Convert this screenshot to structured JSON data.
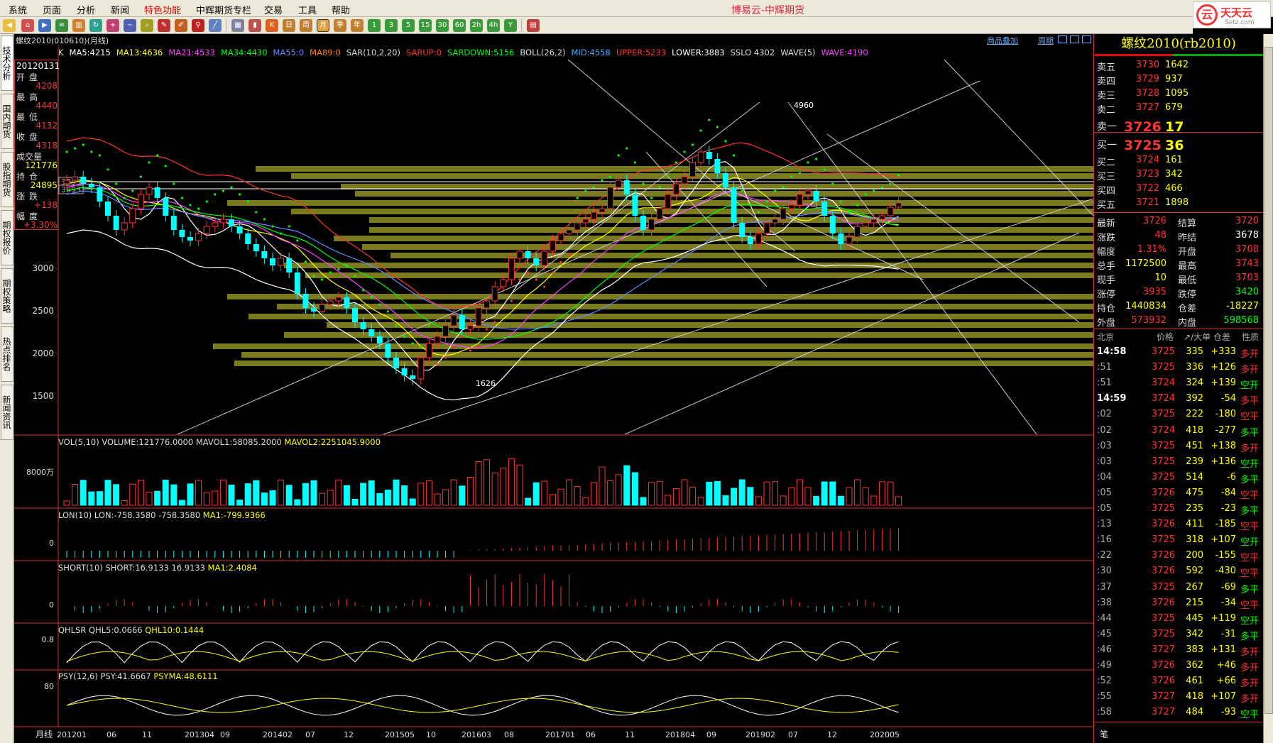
{
  "menu": {
    "items": [
      "系统",
      "页面",
      "分析",
      "新闻",
      "特色功能",
      "中辉期货专栏",
      "交易",
      "工具",
      "帮助"
    ],
    "app_title": "博易云-中辉期货"
  },
  "logo": {
    "mark": "云",
    "text": "天天云",
    "url": "Setz.com"
  },
  "toolbar": {
    "period_buttons": [
      "日",
      "周",
      "月",
      "季",
      "年"
    ]
  },
  "left_tabs": [
    "技术分析",
    "国内期货",
    "股指期货",
    "期权报价",
    "期权策略",
    "热点排名",
    "新闻资讯"
  ],
  "chart": {
    "title": "螺纹2010(010610)(月线)",
    "overlay_link": "商品叠加",
    "period_link": "周期",
    "indicator_line": [
      {
        "text": "K",
        "color": "#dddddd"
      },
      {
        "text": "MA5:4215",
        "color": "#ffffff"
      },
      {
        "text": "MA13:4636",
        "color": "#ffff00"
      },
      {
        "text": "MA21:4533",
        "color": "#ff44ff"
      },
      {
        "text": "MA34:4430",
        "color": "#00ff00"
      },
      {
        "text": "MA55:0",
        "color": "#6688ff"
      },
      {
        "text": "MA89:0",
        "color": "#ff7f00"
      },
      {
        "text": "SAR(10,2,20)",
        "color": "#dddddd"
      },
      {
        "text": "SARUP:0",
        "color": "#ff3333"
      },
      {
        "text": "SARDOWN:5156",
        "color": "#00ff00"
      },
      {
        "text": "BOLL(26,2)",
        "color": "#dddddd"
      },
      {
        "text": "MID:4558",
        "color": "#44aaff"
      },
      {
        "text": "UPPER:5233",
        "color": "#ff3333"
      },
      {
        "text": "LOWER:3883",
        "color": "#ffffff"
      },
      {
        "text": "SSLO 4302",
        "color": "#dddddd"
      },
      {
        "text": "WAVE(5)",
        "color": "#dddddd"
      },
      {
        "text": "WAVE:4190",
        "color": "#ff44ff"
      }
    ],
    "info_box": {
      "date": "20120131",
      "rows": [
        {
          "label": "开盘",
          "value": "4208"
        },
        {
          "label": "最高",
          "value": "4440"
        },
        {
          "label": "最低",
          "value": "4132"
        },
        {
          "label": "收盘",
          "value": "4318"
        },
        {
          "label": "成交量",
          "value": "121776"
        },
        {
          "label": "持仓",
          "value": "24895"
        },
        {
          "label": "涨跌",
          "value": "+138"
        },
        {
          "label": "幅度",
          "value": "+3.30%"
        }
      ]
    },
    "price_axis": [
      "3000",
      "2500",
      "2000",
      "1500"
    ],
    "price_tags": [
      "3993",
      "3893"
    ],
    "annotations": {
      "high": "4960",
      "low": "1626"
    },
    "vol_panel": {
      "label": "VOL(5,10)  VOLUME:121776.0000  MAVOL1:58085.2000",
      "label2": "MAVOL2:2251045.9000",
      "axis": "8000万"
    },
    "lon_panel": {
      "label": "LON(10)  LON:-758.3580  -758.3580",
      "label2": "MA1:-799.9366",
      "axis": "0"
    },
    "short_panel": {
      "label": "SHORT(10)  SHORT:16.9133  16.9133",
      "label2": "MA1:2.4084",
      "axis": "0"
    },
    "qhlsr_panel": {
      "label": "QHLSR  QHL5:0.0666",
      "label2": "QHL10:0.1444",
      "axis": "0.8"
    },
    "psy_panel": {
      "label": "PSY(12,6)  PSY:41.6667",
      "label2": "PSYMA:48.6111",
      "axis": "80"
    },
    "x_axis_label": "月线",
    "x_axis": [
      "201201",
      "06",
      "11",
      "201304",
      "09",
      "201402",
      "07",
      "12",
      "201505",
      "10",
      "201603",
      "08",
      "201701",
      "06",
      "11",
      "201804",
      "09",
      "201902",
      "07",
      "12",
      "202005"
    ]
  },
  "quote": {
    "title": "螺纹2010(rb2010)",
    "asks": [
      {
        "label": "卖五",
        "price": "3730",
        "vol": "1642"
      },
      {
        "label": "卖四",
        "price": "3729",
        "vol": "937"
      },
      {
        "label": "卖三",
        "price": "3728",
        "vol": "1095"
      },
      {
        "label": "卖二",
        "price": "3727",
        "vol": "679"
      },
      {
        "label": "卖一",
        "price": "3726",
        "vol": "17"
      }
    ],
    "bids": [
      {
        "label": "买一",
        "price": "3725",
        "vol": "36"
      },
      {
        "label": "买二",
        "price": "3724",
        "vol": "161"
      },
      {
        "label": "买三",
        "price": "3723",
        "vol": "342"
      },
      {
        "label": "买四",
        "price": "3722",
        "vol": "466"
      },
      {
        "label": "买五",
        "price": "3721",
        "vol": "1898"
      }
    ],
    "stats": [
      {
        "l1": "最新",
        "v1": "3726",
        "c1": "#ff3333",
        "l2": "结算",
        "v2": "3720",
        "c2": "#ff3333"
      },
      {
        "l1": "涨跌",
        "v1": "48",
        "c1": "#ff3333",
        "l2": "昨结",
        "v2": "3678",
        "c2": "#ffffff"
      },
      {
        "l1": "幅度",
        "v1": "1.31%",
        "c1": "#ff3333",
        "l2": "开盘",
        "v2": "3708",
        "c2": "#ff3333"
      },
      {
        "l1": "总手",
        "v1": "1172500",
        "c1": "#ffff00",
        "l2": "最高",
        "v2": "3743",
        "c2": "#ff3333"
      },
      {
        "l1": "现手",
        "v1": "10",
        "c1": "#ffff00",
        "l2": "最低",
        "v2": "3703",
        "c2": "#ff3333"
      },
      {
        "l1": "涨停",
        "v1": "3935",
        "c1": "#ff3333",
        "l2": "跌停",
        "v2": "3420",
        "c2": "#00ff00"
      },
      {
        "l1": "持仓",
        "v1": "1440834",
        "c1": "#ffff00",
        "l2": "仓差",
        "v2": "-18227",
        "c2": "#ffff00"
      },
      {
        "l1": "外盘",
        "v1": "573932",
        "c1": "#ff3333",
        "l2": "内盘",
        "v2": "598568",
        "c2": "#00ff00"
      }
    ],
    "tick_header": [
      "北京",
      "价格",
      "↗/大单",
      "仓差",
      "性质"
    ],
    "ticks": [
      {
        "t": "14:58",
        "p": "3725",
        "v": "335",
        "d": "+333",
        "n": "多开",
        "tc": "#ffffff",
        "nc": "#ff3333"
      },
      {
        "t": ":51",
        "p": "3725",
        "v": "336",
        "d": "+126",
        "n": "多开",
        "tc": "#aaaaaa",
        "nc": "#ff3333"
      },
      {
        "t": ":51",
        "p": "3724",
        "v": "324",
        "d": "+139",
        "n": "空开",
        "tc": "#aaaaaa",
        "nc": "#00ff00"
      },
      {
        "t": "14:59",
        "p": "3724",
        "v": "392",
        "d": "-54",
        "n": "多平",
        "tc": "#ffffff",
        "nc": "#ff3333"
      },
      {
        "t": ":02",
        "p": "3725",
        "v": "222",
        "d": "-180",
        "n": "空平",
        "tc": "#aaaaaa",
        "nc": "#ff3333"
      },
      {
        "t": ":02",
        "p": "3724",
        "v": "418",
        "d": "-277",
        "n": "多平",
        "tc": "#aaaaaa",
        "nc": "#00ff00"
      },
      {
        "t": ":03",
        "p": "3725",
        "v": "451",
        "d": "+138",
        "n": "多开",
        "tc": "#aaaaaa",
        "nc": "#ff3333"
      },
      {
        "t": ":03",
        "p": "3725",
        "v": "239",
        "d": "+136",
        "n": "空开",
        "tc": "#aaaaaa",
        "nc": "#00ff00"
      },
      {
        "t": ":04",
        "p": "3725",
        "v": "514",
        "d": "-6",
        "n": "多平",
        "tc": "#aaaaaa",
        "nc": "#00ff00"
      },
      {
        "t": ":05",
        "p": "3726",
        "v": "475",
        "d": "-84",
        "n": "空平",
        "tc": "#aaaaaa",
        "nc": "#ff3333"
      },
      {
        "t": ":05",
        "p": "3725",
        "v": "235",
        "d": "-23",
        "n": "多平",
        "tc": "#aaaaaa",
        "nc": "#00ff00"
      },
      {
        "t": ":13",
        "p": "3726",
        "v": "411",
        "d": "-185",
        "n": "空平",
        "tc": "#aaaaaa",
        "nc": "#ff3333"
      },
      {
        "t": ":16",
        "p": "3725",
        "v": "318",
        "d": "+107",
        "n": "空开",
        "tc": "#aaaaaa",
        "nc": "#00ff00"
      },
      {
        "t": ":22",
        "p": "3726",
        "v": "200",
        "d": "-155",
        "n": "空平",
        "tc": "#aaaaaa",
        "nc": "#ff3333"
      },
      {
        "t": ":30",
        "p": "3726",
        "v": "592",
        "d": "-430",
        "n": "空平",
        "tc": "#aaaaaa",
        "nc": "#ff3333"
      },
      {
        "t": ":37",
        "p": "3725",
        "v": "267",
        "d": "-69",
        "n": "多平",
        "tc": "#aaaaaa",
        "nc": "#00ff00"
      },
      {
        "t": ":38",
        "p": "3726",
        "v": "215",
        "d": "-34",
        "n": "空平",
        "tc": "#aaaaaa",
        "nc": "#ff3333"
      },
      {
        "t": ":44",
        "p": "3725",
        "v": "445",
        "d": "+119",
        "n": "空开",
        "tc": "#aaaaaa",
        "nc": "#00ff00"
      },
      {
        "t": ":45",
        "p": "3725",
        "v": "342",
        "d": "-31",
        "n": "多平",
        "tc": "#aaaaaa",
        "nc": "#00ff00"
      },
      {
        "t": ":46",
        "p": "3727",
        "v": "383",
        "d": "+131",
        "n": "多开",
        "tc": "#aaaaaa",
        "nc": "#ff3333"
      },
      {
        "t": ":49",
        "p": "3726",
        "v": "362",
        "d": "+46",
        "n": "多开",
        "tc": "#aaaaaa",
        "nc": "#ff3333"
      },
      {
        "t": ":52",
        "p": "3726",
        "v": "461",
        "d": "+66",
        "n": "多开",
        "tc": "#aaaaaa",
        "nc": "#ff3333"
      },
      {
        "t": ":55",
        "p": "3727",
        "v": "418",
        "d": "+107",
        "n": "多开",
        "tc": "#aaaaaa",
        "nc": "#ff3333"
      },
      {
        "t": ":58",
        "p": "3727",
        "v": "484",
        "d": "-93",
        "n": "空平",
        "tc": "#aaaaaa",
        "nc": "#00ff00"
      }
    ],
    "footer": "笔"
  }
}
